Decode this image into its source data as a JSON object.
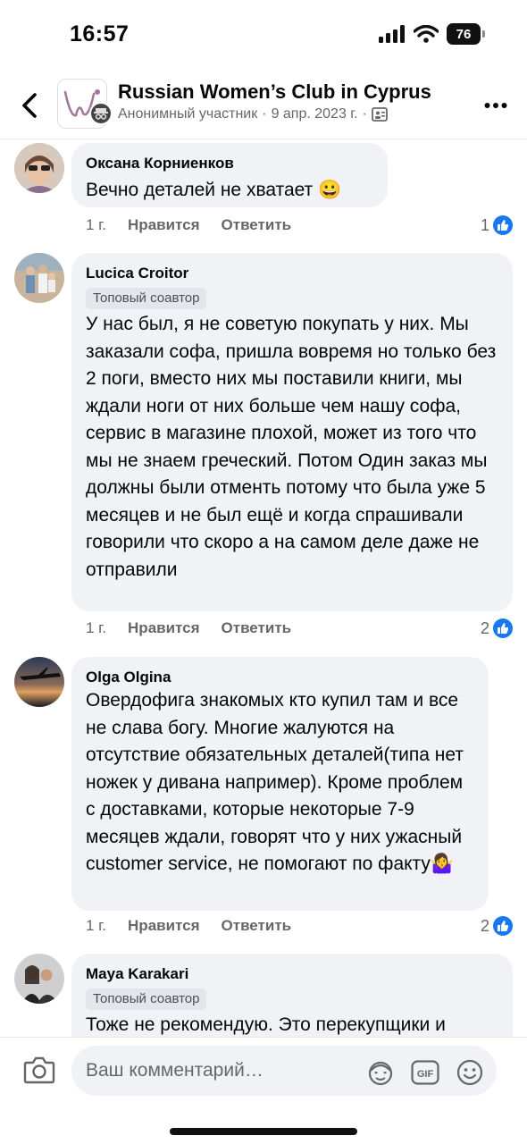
{
  "status_bar": {
    "time": "16:57",
    "battery": "76"
  },
  "header": {
    "title": "Russian Women’s Club in Cyprus",
    "author": "Анонимный участник",
    "separator": "·",
    "date": "9 апр. 2023 г.",
    "separator2": "·"
  },
  "comments": [
    {
      "author": "Оксана Корниенков",
      "badge": "",
      "text": "Вечно деталей не хватает 😀",
      "time": "1 г.",
      "like_label": "Нравится",
      "reply_label": "Ответить",
      "reactions": "1"
    },
    {
      "author": "Lucica Croitor",
      "badge": "Топовый соавтор",
      "text": "У нас был, я не советую покупать у них. Мы заказали софа, пришла вовремя но только без 2 поги, вместо них мы поставили книги, мы ждали ноги от них больше чем нашу софа, сервис в магазине плохой, может из того что мы не знаем греческий. Потом Один заказ мы должны были отменть потому что была уже 5 месяцев и не был ещё и когда спрашивали говорили что скоро а на самом деле даже не отправили",
      "time": "1 г.",
      "like_label": "Нравится",
      "reply_label": "Ответить",
      "reactions": "2"
    },
    {
      "author": "Olga Olgina",
      "badge": "",
      "text": "Овердофига знакомых кто купил там и все не слава богу. Многие жалуются на отсутствие обязательных деталей(типа нет ножек у дивана например). Кроме проблем с доставками, которые некоторые 7-9 месяцев ждали, говорят что у них ужасный customer service, не помогают по факту🤷‍♀️",
      "time": "1 г.",
      "like_label": "Нравится",
      "reply_label": "Ответить",
      "reactions": "2"
    },
    {
      "author": "Maya Karakari",
      "badge": "Топовый соавтор",
      "text": "Тоже не рекомендую. Это перекупщики и",
      "time": "",
      "like_label": "",
      "reply_label": "",
      "reactions": ""
    }
  ],
  "composer": {
    "placeholder": "Ваш комментарий…",
    "gif_label": "GIF"
  },
  "colors": {
    "accent": "#1877f2",
    "bubble": "#f0f2f5",
    "secondary_text": "#65676b"
  }
}
